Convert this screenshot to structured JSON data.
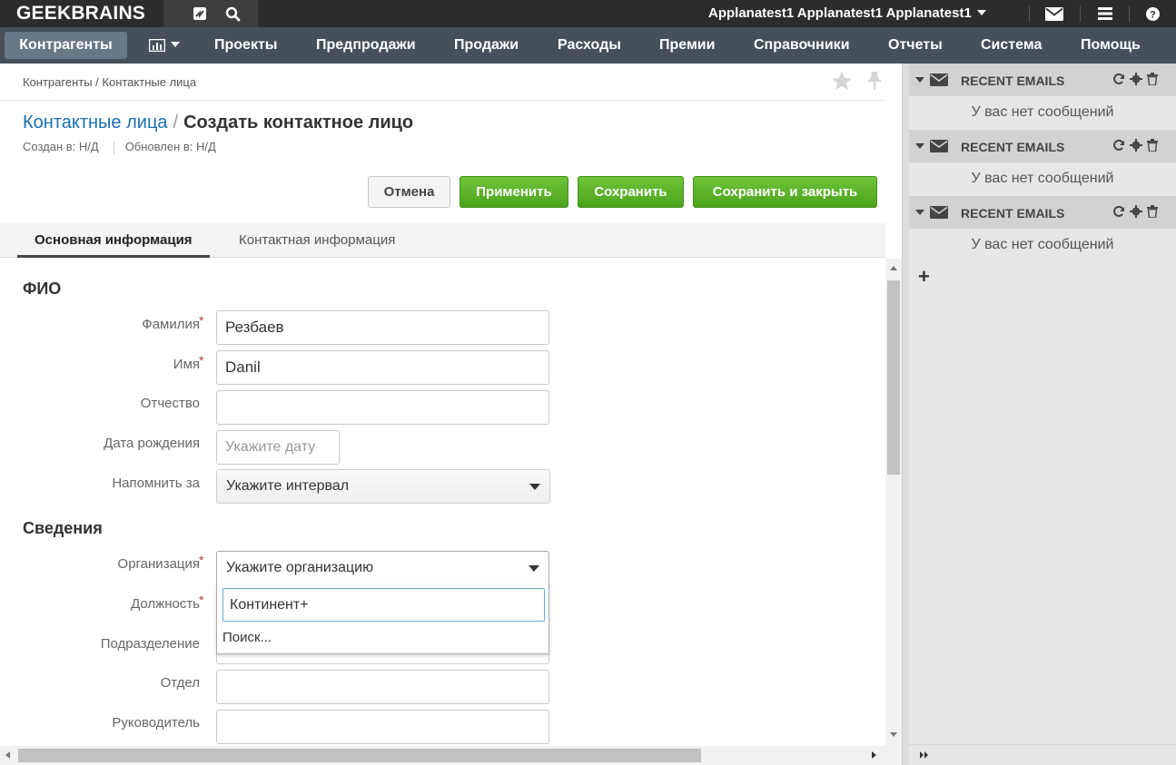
{
  "topbar": {
    "logo": "GEEKBRAINS",
    "user_name": "Applanatest1 Applanatest1 Applanatest1"
  },
  "nav": {
    "active": "Контрагенты",
    "items": [
      "Проекты",
      "Предпродажи",
      "Продажи",
      "Расходы",
      "Премии",
      "Справочники",
      "Отчеты",
      "Система",
      "Помощь"
    ]
  },
  "breadcrumb": "Контрагенты / Контактные лица",
  "title": {
    "link": "Контактные лица",
    "separator": "/",
    "current": "Создать контактное лицо"
  },
  "meta": {
    "created": "Создан в: Н/Д",
    "updated": "Обновлен в: Н/Д"
  },
  "buttons": {
    "cancel": "Отмена",
    "apply": "Применить",
    "save": "Сохранить",
    "save_close": "Сохранить и закрыть"
  },
  "tabs": [
    "Основная информация",
    "Контактная информация"
  ],
  "sections": {
    "fio": "ФИО",
    "info": "Сведения"
  },
  "form": {
    "last_name": {
      "label": "Фамилия",
      "value": "Резбаев"
    },
    "first_name": {
      "label": "Имя",
      "value": "Danil"
    },
    "middle_name": {
      "label": "Отчество",
      "value": ""
    },
    "birth_date": {
      "label": "Дата рождения",
      "placeholder": "Укажите дату"
    },
    "remind": {
      "label": "Напомнить за",
      "value": "Укажите интервал"
    },
    "organization": {
      "label": "Организация",
      "value": "Укажите организацию"
    },
    "position": {
      "label": "Должность"
    },
    "subdivision": {
      "label": "Подразделение"
    },
    "department": {
      "label": "Отдел",
      "value": ""
    },
    "manager": {
      "label": "Руководитель",
      "value": ""
    }
  },
  "org_dropdown": {
    "search_value": "Континент+",
    "hint": "Поиск..."
  },
  "sidebar": {
    "widgets": [
      {
        "title": "RECENT EMAILS",
        "empty": "У вас нет сообщений"
      },
      {
        "title": "RECENT EMAILS",
        "empty": "У вас нет сообщений"
      },
      {
        "title": "RECENT EMAILS",
        "empty": "У вас нет сообщений"
      }
    ],
    "add": "+"
  },
  "colors": {
    "topbar": "#2c2c2c",
    "navbar": "#45505b",
    "link": "#1a6fb5",
    "green_button": "#5bb12a",
    "required": "#c0392b"
  }
}
